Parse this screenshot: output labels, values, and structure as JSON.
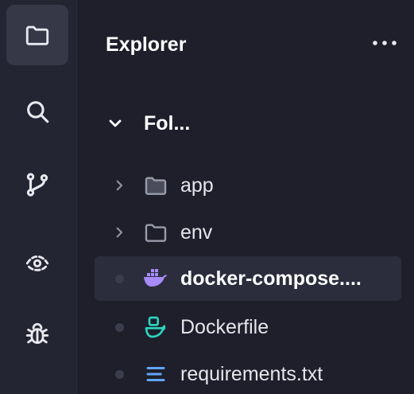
{
  "activity_bar": {
    "items": [
      {
        "icon": "folder-icon",
        "active": true
      },
      {
        "icon": "search-icon",
        "active": false
      },
      {
        "icon": "source-control-icon",
        "active": false
      },
      {
        "icon": "eye-icon",
        "active": false
      },
      {
        "icon": "bug-icon",
        "active": false
      }
    ]
  },
  "explorer": {
    "title": "Explorer",
    "more_label": "⋯",
    "folder": {
      "name": "Fol...",
      "expanded": true
    },
    "items": [
      {
        "label": "app",
        "type": "folder",
        "icon": "folder-icon"
      },
      {
        "label": "env",
        "type": "folder",
        "icon": "folder-icon"
      },
      {
        "label": "docker-compose....",
        "type": "file",
        "icon": "docker-icon",
        "selected": true
      },
      {
        "label": "Dockerfile",
        "type": "file",
        "icon": "dockerfile-icon"
      },
      {
        "label": "requirements.txt",
        "type": "file",
        "icon": "text-lines-icon"
      }
    ]
  },
  "colors": {
    "background": "#1e1f2b",
    "activity_bar": "#242533",
    "active_item": "#363848",
    "selected_row": "#2b2d3d",
    "docker_icon": "#a78bfa",
    "dockerfile_icon": "#2dd4bf",
    "text_icon": "#60a5fa",
    "folder_icon": "#9a9cab"
  }
}
